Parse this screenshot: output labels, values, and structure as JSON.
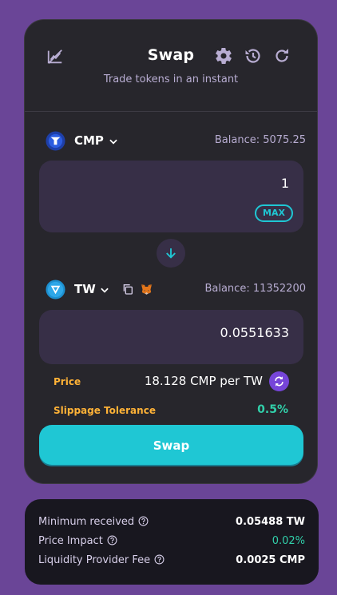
{
  "header": {
    "title": "Swap",
    "subtitle": "Trade tokens in an instant",
    "icons": [
      "chart-disabled-icon",
      "gear-icon",
      "history-icon",
      "refresh-icon"
    ]
  },
  "from": {
    "token": "CMP",
    "balance": "Balance: 5075.25",
    "amount": "1",
    "max_label": "MAX"
  },
  "to": {
    "token": "TW",
    "balance": "Balance: 11352200",
    "amount": "0.0551633"
  },
  "price": {
    "label": "Price",
    "value": "18.128 CMP per TW"
  },
  "slippage": {
    "label": "Slippage Tolerance",
    "value": "0.5%"
  },
  "swap_button": "Swap",
  "details": [
    {
      "label": "Minimum received",
      "value": "0.05488 TW"
    },
    {
      "label": "Price Impact",
      "value": "0.02%"
    },
    {
      "label": "Liquidity Provider Fee",
      "value": "0.0025 CMP"
    }
  ],
  "colors": {
    "background": "#6a4597",
    "card": "#27262c",
    "input": "#372f47",
    "primary": "#1fc7d4",
    "success": "#31d0aa",
    "warning": "#ffb237",
    "secondary": "#7645d9"
  }
}
